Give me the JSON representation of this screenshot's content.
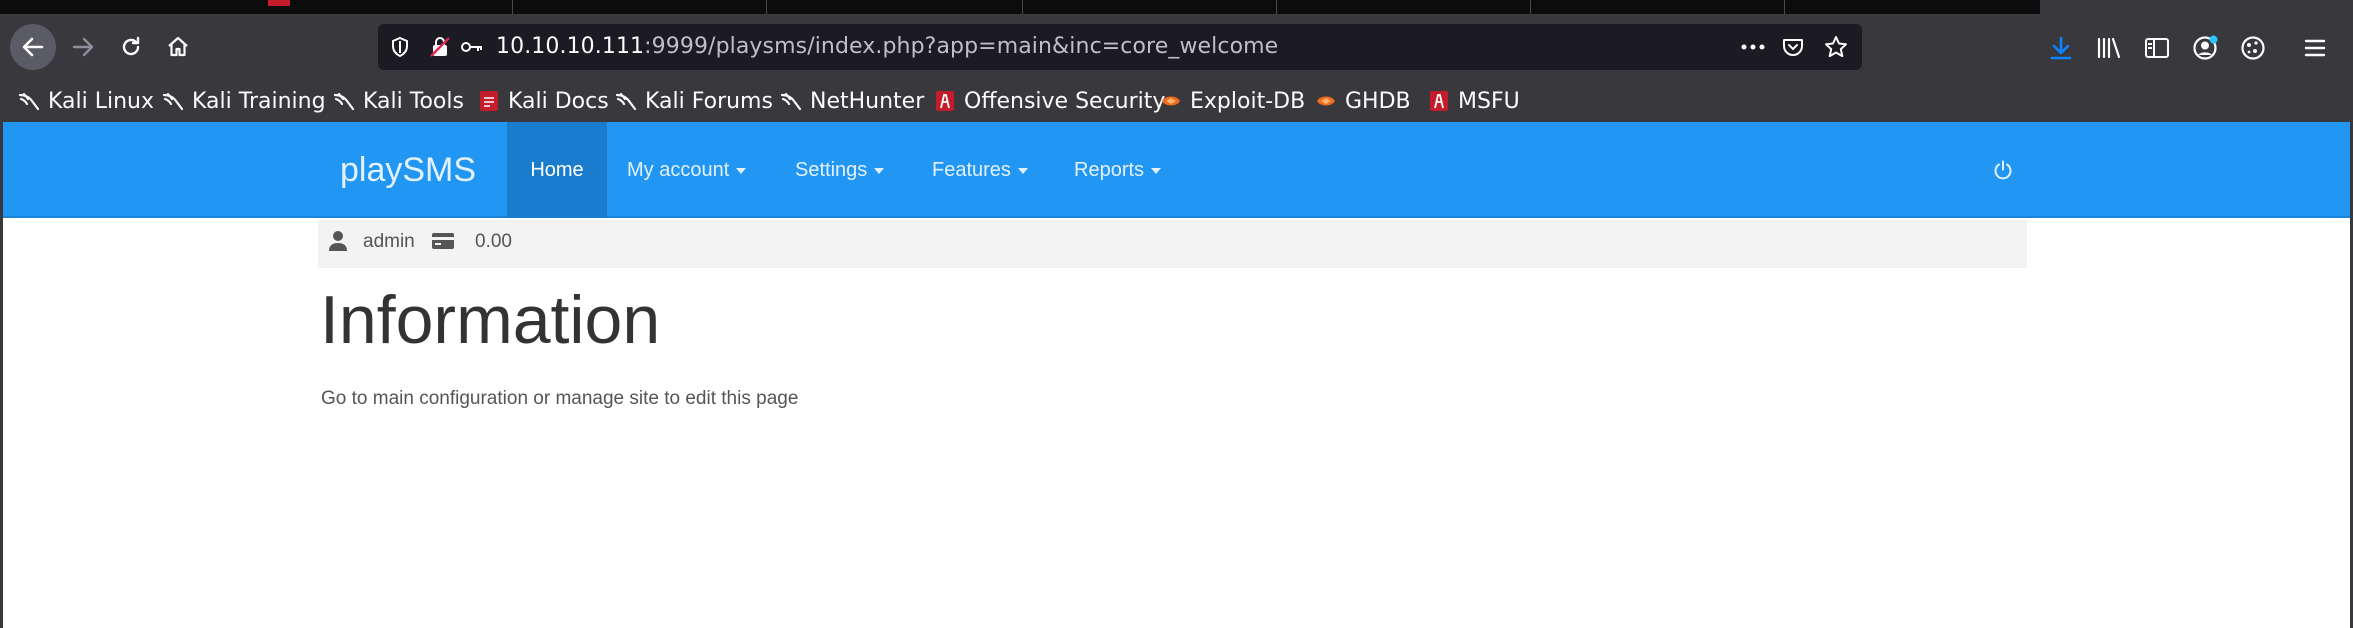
{
  "browser": {
    "url": {
      "host": "10.10.10.111",
      "rest": ":9999/playsms/index.php?app=main&inc=core_welcome"
    },
    "bookmarks": [
      {
        "label": "Kali Linux",
        "icon": "kali-dragon-icon"
      },
      {
        "label": "Kali Training",
        "icon": "kali-dragon-icon"
      },
      {
        "label": "Kali Tools",
        "icon": "kali-dragon-icon"
      },
      {
        "label": "Kali Docs",
        "icon": "kali-docs-icon"
      },
      {
        "label": "Kali Forums",
        "icon": "kali-dragon-icon"
      },
      {
        "label": "NetHunter",
        "icon": "kali-dragon-icon"
      },
      {
        "label": "Offensive Security",
        "icon": "offsec-icon"
      },
      {
        "label": "Exploit-DB",
        "icon": "exploit-db-icon"
      },
      {
        "label": "GHDB",
        "icon": "exploit-db-icon"
      },
      {
        "label": "MSFU",
        "icon": "offsec-icon"
      }
    ],
    "colors": {
      "chrome": "#38383d",
      "accent_blue": "#0a84ff"
    }
  },
  "app": {
    "brand": "playSMS",
    "menu": [
      {
        "label": "Home",
        "active": true
      },
      {
        "label": "My account"
      },
      {
        "label": "Settings"
      },
      {
        "label": "Features"
      },
      {
        "label": "Reports"
      }
    ],
    "colors": {
      "navbar": "#2196f3",
      "active_tab": "#1a7ccd"
    }
  },
  "userbar": {
    "username": "admin",
    "credit": "0.00"
  },
  "content": {
    "title": "Information",
    "message": "Go to main configuration or manage site to edit this page"
  }
}
